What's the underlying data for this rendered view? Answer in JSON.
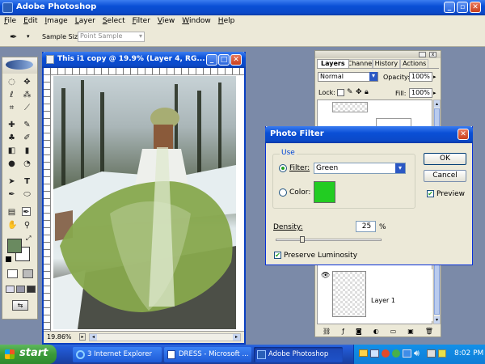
{
  "app": {
    "title": "Adobe Photoshop"
  },
  "menu": [
    "File",
    "Edit",
    "Image",
    "Layer",
    "Select",
    "Filter",
    "View",
    "Window",
    "Help"
  ],
  "options_bar": {
    "sample_size_label": "Sample Size:",
    "sample_size_value": "Point Sample"
  },
  "document": {
    "title": "This i1 copy @ 19.9% (Layer 4, RG...",
    "zoom": "19.86%"
  },
  "layers_panel": {
    "tabs": [
      "Layers",
      "Channels",
      "History",
      "Actions"
    ],
    "blend_mode": "Normal",
    "opacity_label": "Opacity:",
    "opacity_value": "100%",
    "lock_label": "Lock:",
    "fill_label": "Fill:",
    "fill_value": "100%",
    "layer_name": "Layer 1"
  },
  "dialog": {
    "title": "Photo Filter",
    "use_group": "Use",
    "filter_label": "Filter:",
    "filter_value": "Green",
    "color_label": "Color:",
    "color_swatch": "#22cc22",
    "density_label": "Density:",
    "density_value": "25",
    "density_unit": "%",
    "density_fraction": 0.25,
    "preserve_label": "Preserve Luminosity",
    "ok_label": "OK",
    "cancel_label": "Cancel",
    "preview_label": "Preview"
  },
  "taskbar": {
    "start_label": "start",
    "items": [
      "3 Internet Explorer",
      "DRESS - Microsoft ...",
      "Adobe Photoshop"
    ],
    "clock": "8:02 PM"
  },
  "colors": {
    "foreground": "#6a8a60",
    "background": "#ffffff"
  }
}
